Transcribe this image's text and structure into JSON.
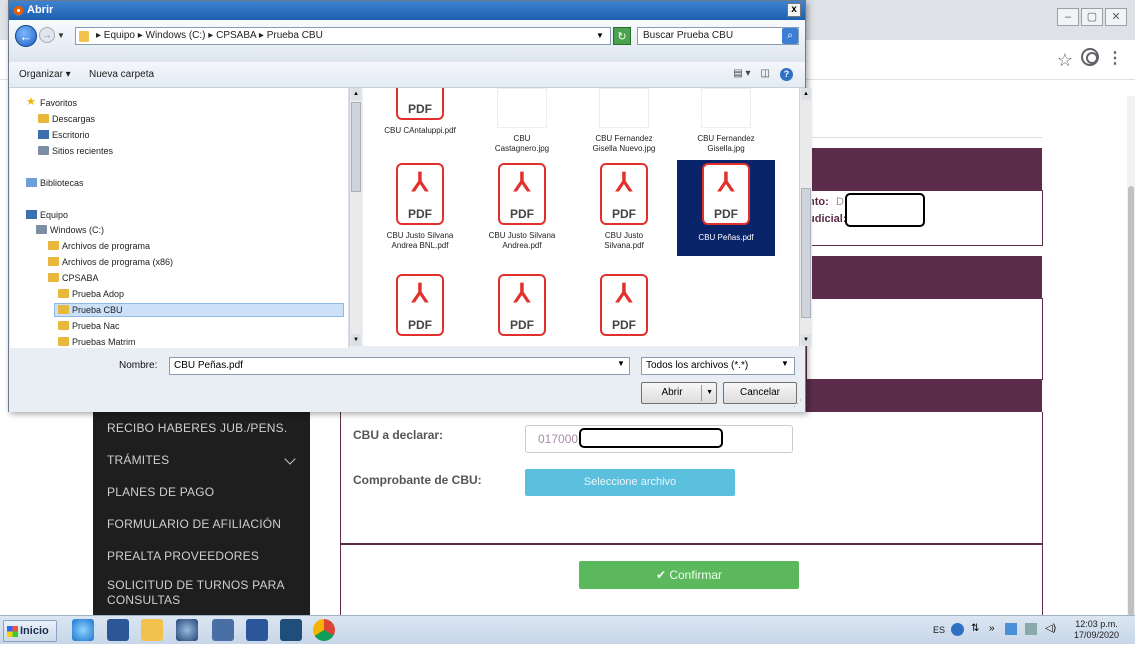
{
  "browser": {
    "window_controls": [
      "–",
      "▢",
      "✕"
    ]
  },
  "page": {
    "info_labels": [
      "nto:",
      "D",
      "udicial:"
    ],
    "side_menu": [
      {
        "label": "RECIBO HABERES JUB./PENS."
      },
      {
        "label": "TRÁMITES"
      },
      {
        "label": "PLANES DE PAGO"
      },
      {
        "label": "FORMULARIO DE AFILIACIÓN"
      },
      {
        "label": "PREALTA PROVEEDORES"
      },
      {
        "label": "SOLICITUD DE TURNOS PARA CONSULTAS"
      }
    ],
    "form": {
      "cbu_label": "CBU a declarar:",
      "cbu_value": "017000",
      "comprobante_label": "Comprobante de CBU:",
      "file_button": "Seleccione archivo",
      "confirm_button": "✔  Confirmar"
    }
  },
  "dialog": {
    "title": "Abrir",
    "breadcrumb": "▸ Equipo ▸ Windows (C:) ▸ CPSABA ▸ Prueba CBU",
    "search_placeholder": "Buscar Prueba CBU",
    "toolbar": {
      "organize": "Organizar ▾",
      "new_folder": "Nueva carpeta"
    },
    "nav_tree": [
      {
        "label": "Favoritos",
        "icon": "star-icon"
      },
      {
        "label": "Descargas",
        "icon": "folder-icon"
      },
      {
        "label": "Escritorio",
        "icon": "folder-icon"
      },
      {
        "label": "Sitios recientes",
        "icon": "folder-icon"
      },
      {
        "label": "Bibliotecas",
        "icon": "library-icon"
      },
      {
        "label": "Equipo",
        "icon": "computer-icon"
      },
      {
        "label": "Windows (C:)",
        "icon": "drive-icon"
      },
      {
        "label": "Archivos de programa",
        "icon": "folder-icon"
      },
      {
        "label": "Archivos de programa (x86)",
        "icon": "folder-icon"
      },
      {
        "label": "CPSABA",
        "icon": "folder-icon"
      },
      {
        "label": "Prueba Adop",
        "icon": "folder-icon"
      },
      {
        "label": "Prueba CBU",
        "icon": "folder-icon",
        "selected": true
      },
      {
        "label": "Prueba Nac",
        "icon": "folder-icon"
      },
      {
        "label": "Pruebas Matrim",
        "icon": "folder-icon"
      }
    ],
    "files": [
      {
        "name": "CBU CAntaluppi.pdf",
        "type": "pdf"
      },
      {
        "name": "CBU Castagnero.jpg",
        "type": "jpg"
      },
      {
        "name": "CBU Fernandez Gisella Nuevo.jpg",
        "type": "jpg"
      },
      {
        "name": "CBU Fernandez Gisella.jpg",
        "type": "jpg"
      },
      {
        "name": "CBU Justo Silvana Andrea BNL.pdf",
        "type": "pdf"
      },
      {
        "name": "CBU Justo Silvana Andrea.pdf",
        "type": "pdf"
      },
      {
        "name": "CBU Justo Silvana.pdf",
        "type": "pdf"
      },
      {
        "name": "CBU Peñas.pdf",
        "type": "pdf",
        "selected": true
      },
      {
        "name": "",
        "type": "pdf"
      },
      {
        "name": "",
        "type": "pdf"
      },
      {
        "name": "",
        "type": "pdf"
      }
    ],
    "pdf_label": "PDF",
    "name_label": "Nombre:",
    "name_value": "CBU Peñas.pdf",
    "file_type": "Todos los archivos (*.*)",
    "open_button": "Abrir",
    "cancel_button": "Cancelar"
  },
  "taskbar": {
    "start": "Inicio",
    "language": "ES",
    "time": "12:03 p.m.",
    "date": "17/09/2020"
  }
}
